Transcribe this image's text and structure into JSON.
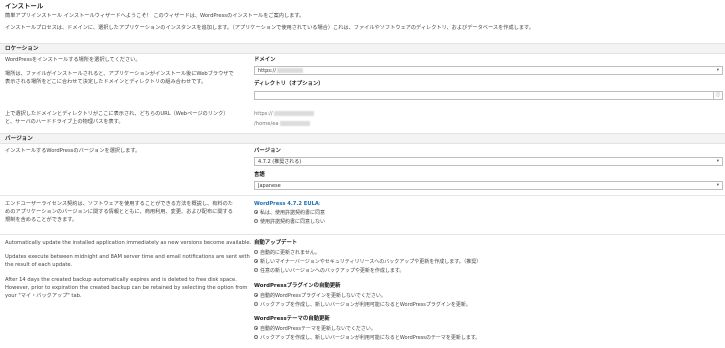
{
  "header": {
    "title": "インストール",
    "intro1": "簡単アプリインストール インストールウィザードへようこそ！ このウィザードは、WordPressのインストールをご案内します。",
    "intro2": "インストールプロセスは、ドメインに、選択したアプリケーションのインスタンスを追加します。（アプリケーションで使用されている場合）これは、ファイルやソフトウェアのディレクトリ、およびデータベースを作成します。"
  },
  "location": {
    "section_title": "ロケーション",
    "desc1": "WordPressをインストールする場所を選択してください。",
    "desc2_l1": "場所は、ファイルがインストールされると、アプリケーションがインストール後にWebブラウザで",
    "desc2_l2": "表示される場所をどこに合わせて決定したドメインとディレクトリの組み合わせです。",
    "domain_label": "ドメイン",
    "domain_value": "https://",
    "directory_label": "ディレクトリ（オプション）",
    "directory_value": "",
    "url_note_l1": "上で選択したドメインとディレクトリがここに表示され、どちらのURL（Webページのリンク）",
    "url_note_l2": "と、サーバのハードドライブ上の物理パスを表す。",
    "url_preview": "https://",
    "path_preview": "/home/ea"
  },
  "version": {
    "section_title": "バージョン",
    "desc": "インストールするWordPressのバージョンを選択します。",
    "version_label": "バージョン",
    "version_value": "4.7.2 (推奨される)",
    "language_label": "言語",
    "language_value": "Japanese"
  },
  "eula": {
    "desc_l1": "エンドユーザーライセンス契約は、ソフトウェアを使用することができる方法を概説し、有料のた",
    "desc_l2": "めのアプリケーションのバージョンに関する情報とともに、商用利用、変更、および配布に関する",
    "desc_l3": "規制を含めることができます。",
    "link": "WordPress 4.7.2 EULA",
    "link_suffix": ":",
    "agree": "私は、使用許諾契約書に同意",
    "disagree": "使用許諾契約書に同意しない"
  },
  "autoupdate": {
    "desc1": "Automatically update the installed application immediately as new versions become available.",
    "desc2_l1": "Updates execute between midnight and 8AM server time and email notifications are sent with",
    "desc2_l2": "the result of each update.",
    "desc3_l1": "After 14 days the created backup automatically expires and is deleted to free disk space.",
    "desc3_l2": "However, prior to expiration the created backup can be retained by selecting the option from",
    "desc3_l3": "your \"マイ・バックアップ\" tab.",
    "group1_label": "自動アップデート",
    "g1_opt1": "自動的に更新されません。",
    "g1_opt2": "新しいマイナーバージョンやセキュリティリリースへのバックアップや更新を作成します。（推奨）",
    "g1_opt3": "任意の新しいバージョンへのバックアップや更新を作成します。",
    "group2_label": "WordPressプラグインの自動更新",
    "g2_opt1": "自動的WordPressプラグインを更新しないでください。",
    "g2_opt2": "バックアップを作成し、新しいバージョンが利用可能になるとWordPressプラグインを更新。",
    "group3_label": "WordPressテーマの自動更新",
    "g3_opt1": "自動的WordPressテーマを更新しないでください。",
    "g3_opt2": "バックアップを作成し、新しいバージョンが利用可能になるとWordPressのテーマを更新します。"
  }
}
